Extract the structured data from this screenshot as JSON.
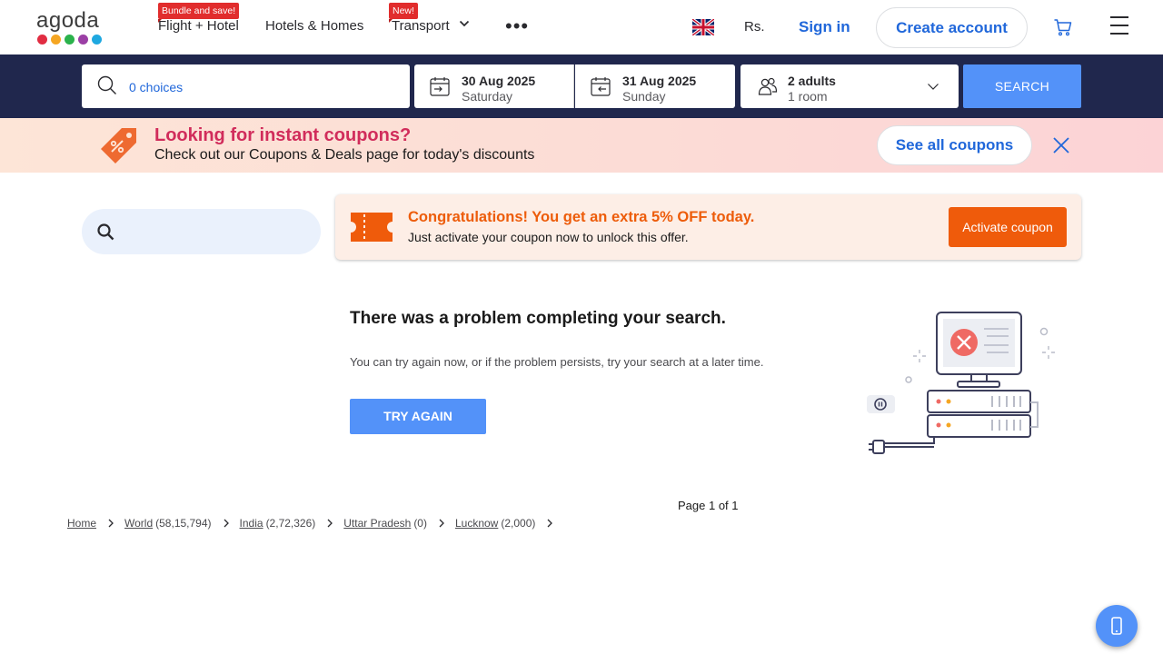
{
  "logo": {
    "text": "agoda",
    "dot_colors": [
      "#e12d42",
      "#f5a623",
      "#2bb24c",
      "#9b3fa5",
      "#1fa8e0"
    ]
  },
  "nav": {
    "items": [
      {
        "label": "Flight + Hotel",
        "badge": "Bundle and save!"
      },
      {
        "label": "Hotels & Homes",
        "badge": ""
      },
      {
        "label": "Transport",
        "badge": "New!"
      }
    ],
    "more": "•••",
    "currency": "Rs.",
    "sign_in": "Sign in",
    "create_account": "Create account"
  },
  "search": {
    "destination_placeholder": "0 choices",
    "check_in": {
      "date": "30 Aug 2025",
      "day": "Saturday"
    },
    "check_out": {
      "date": "31 Aug 2025",
      "day": "Sunday"
    },
    "occupancy": {
      "guests": "2 adults",
      "rooms": "1 room"
    },
    "button": "SEARCH"
  },
  "coupon_banner": {
    "title": "Looking for instant coupons?",
    "subtitle": "Check out our Coupons & Deals page for today's discounts",
    "button": "See all coupons"
  },
  "coupon_offer": {
    "title": "Congratulations! You get an extra 5% OFF today.",
    "subtitle": "Just activate your coupon now to unlock this offer.",
    "button": "Activate coupon"
  },
  "error": {
    "title": "There was a problem completing your search.",
    "message": "You can try again now, or if the problem persists, try your search at a later time.",
    "button": "TRY AGAIN"
  },
  "pagination": {
    "text": "Page 1 of 1"
  },
  "breadcrumbs": [
    {
      "label": "Home",
      "count": ""
    },
    {
      "label": "World",
      "count": "(58,15,794)"
    },
    {
      "label": "India",
      "count": "(2,72,326)"
    },
    {
      "label": "Uttar Pradesh",
      "count": "(0)"
    },
    {
      "label": "Lucknow",
      "count": "(2,000)"
    }
  ],
  "colors": {
    "brand_blue": "#2067da",
    "search_band": "#20274d",
    "primary_button": "#5392f9",
    "coupon_orange": "#ef5b0b",
    "coupon_title_pink": "#d12c5b"
  }
}
